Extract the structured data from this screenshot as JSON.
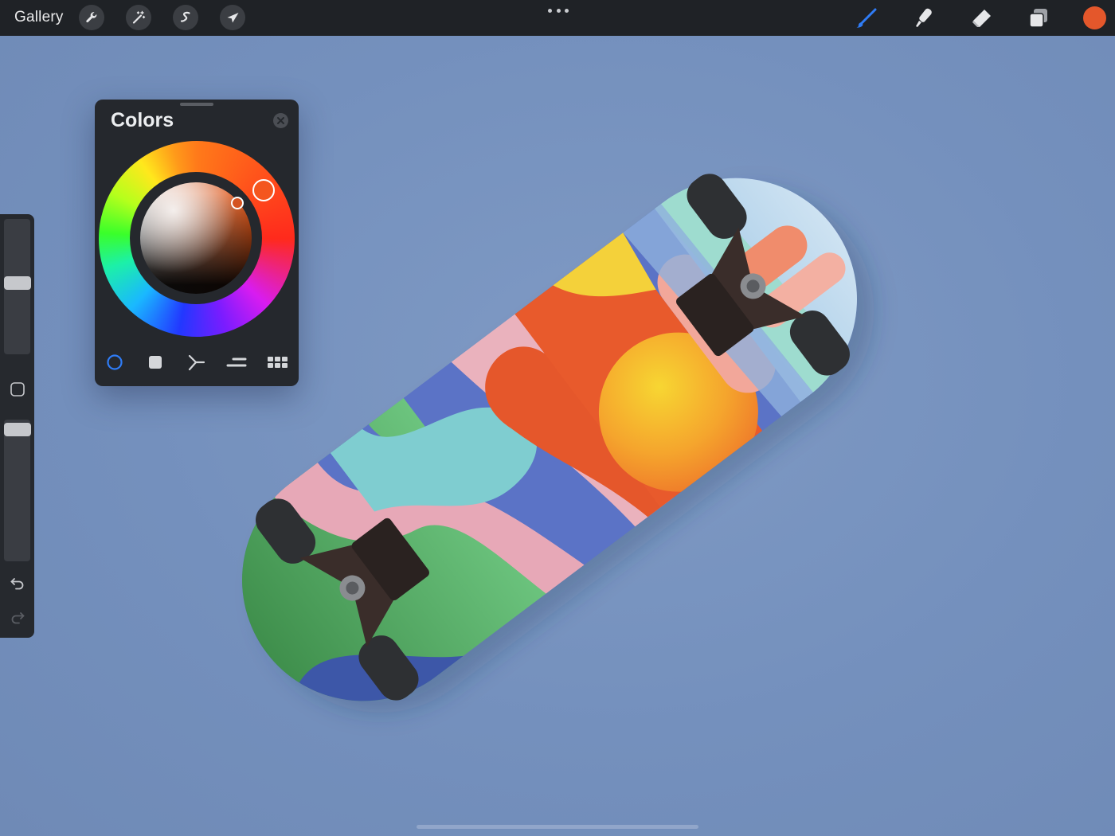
{
  "app": {
    "gallery_label": "Gallery",
    "left_tools": [
      "wrench-icon",
      "magic-wand-icon",
      "selection-s-icon",
      "transform-arrow-icon"
    ],
    "more_menu": "ellipsis-icon",
    "right_tools": [
      "brush-icon",
      "smudge-icon",
      "eraser-icon",
      "layers-icon"
    ],
    "active_tool": "brush",
    "current_color": "#e4572b"
  },
  "sidebar": {
    "brush_size_level": 0.52,
    "opacity_level": 0.9,
    "modify_button": "square-icon",
    "undo_icon": "undo-icon",
    "redo_icon": "redo-icon"
  },
  "colors_panel": {
    "title": "Colors",
    "close_icon": "close-icon",
    "modes": [
      "disc",
      "classic",
      "harmony",
      "value",
      "palettes"
    ],
    "active_mode": "disc",
    "selected_hue_color": "#f4561e",
    "selected_color": "#d45320"
  },
  "canvas": {
    "subject": "skateboard-deck",
    "background_color": "#7490bd"
  }
}
